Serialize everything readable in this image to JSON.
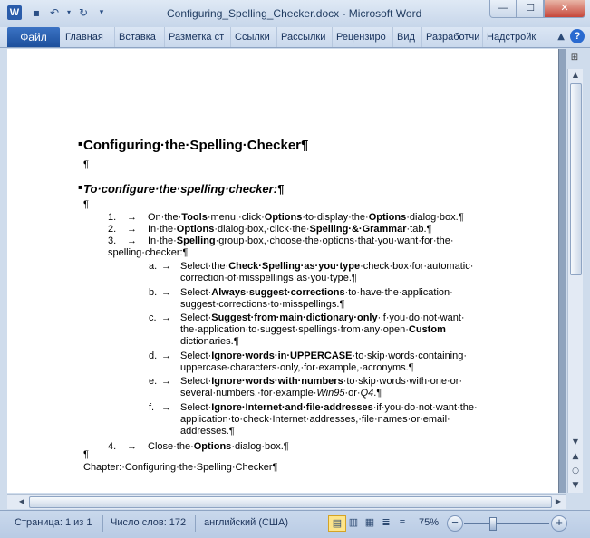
{
  "window": {
    "title": "Configuring_Spelling_Checker.docx - Microsoft Word",
    "app_icon_letter": "W",
    "buttons": {
      "minimize": "—",
      "maximize": "☐",
      "close": "✕"
    }
  },
  "ribbon": {
    "file_tab": "Файл",
    "tabs": [
      "Главная",
      "Вставка",
      "Разметка ст",
      "Ссылки",
      "Рассылки",
      "Рецензиро",
      "Вид",
      "Разработчи",
      "Надстройк"
    ],
    "help": "?"
  },
  "document": {
    "title": "Configuring·the·Spelling·Checker¶",
    "pilcrow": "¶",
    "subtitle": "To·configure·the·spelling·checker:¶",
    "steps": [
      {
        "num": "1.",
        "parts": [
          [
            "",
            "On·the·"
          ],
          [
            "b",
            "Tools"
          ],
          [
            "",
            "·menu,·click·"
          ],
          [
            "b",
            "Options"
          ],
          [
            "",
            "·to·display·the·"
          ],
          [
            "b",
            "Options"
          ],
          [
            "",
            "·dialog·box.¶"
          ]
        ]
      },
      {
        "num": "2.",
        "parts": [
          [
            "",
            "In·the·"
          ],
          [
            "b",
            "Options"
          ],
          [
            "",
            "·dialog·box,·click·the·"
          ],
          [
            "b",
            "Spelling·&·Grammar"
          ],
          [
            "",
            "·tab.¶"
          ]
        ]
      },
      {
        "num": "3.",
        "parts": [
          [
            "",
            "In·the·"
          ],
          [
            "b",
            "Spelling"
          ],
          [
            "",
            "·group·box,·choose·the·options·that·you·want·for·the·"
          ]
        ],
        "cont": "spelling·checker:¶"
      },
      {
        "num": "4.",
        "parts": [
          [
            "",
            "Close·the·"
          ],
          [
            "b",
            "Options"
          ],
          [
            "",
            "·dialog·box.¶"
          ]
        ]
      }
    ],
    "substeps": [
      {
        "letter": "a.",
        "lines": [
          [
            [
              "",
              "Select·the·"
            ],
            [
              "b",
              "Check·Spelling·as·you·type"
            ],
            [
              "",
              "·check·box·for·automatic·"
            ]
          ],
          [
            [
              "",
              "correction·of·misspellings·as·you·type.¶"
            ]
          ]
        ]
      },
      {
        "letter": "b.",
        "lines": [
          [
            [
              "",
              "Select·"
            ],
            [
              "b",
              "Always·suggest·corrections"
            ],
            [
              "",
              "·to·have·the·application·"
            ]
          ],
          [
            [
              "",
              "suggest·corrections·to·misspellings.¶"
            ]
          ]
        ]
      },
      {
        "letter": "c.",
        "lines": [
          [
            [
              "",
              "Select·"
            ],
            [
              "b",
              "Suggest·from·main·dictionary·only"
            ],
            [
              "",
              "·if·you·do·not·want·"
            ]
          ],
          [
            [
              "",
              "the·application·to·suggest·spellings·from·any·open·"
            ],
            [
              "b",
              "Custom"
            ]
          ],
          [
            [
              "",
              "dictionaries.¶"
            ]
          ]
        ]
      },
      {
        "letter": "d.",
        "lines": [
          [
            [
              "",
              "Select·"
            ],
            [
              "b",
              "Ignore·words·in·UPPERCASE"
            ],
            [
              "",
              "·to·skip·words·containing·"
            ]
          ],
          [
            [
              "",
              "uppercase·characters·only,·for·example,·acronyms.¶"
            ]
          ]
        ]
      },
      {
        "letter": "e.",
        "lines": [
          [
            [
              "",
              "Select·"
            ],
            [
              "b",
              "Ignore·words·with·numbers"
            ],
            [
              "",
              "·to·skip·words·with·one·or·"
            ]
          ],
          [
            [
              "",
              "several·numbers,·for·example·"
            ],
            [
              "i",
              "Win95"
            ],
            [
              "",
              "·or·"
            ],
            [
              "i",
              "Q4"
            ],
            [
              "",
              ".¶"
            ]
          ]
        ]
      },
      {
        "letter": "f.",
        "lines": [
          [
            [
              "",
              "Select·"
            ],
            [
              "b",
              "Ignore·Internet·and·file·addresses"
            ],
            [
              "",
              "·if·you·do·not·want·the·"
            ]
          ],
          [
            [
              "",
              "application·to·check·Internet·addresses,·file·names·or·email·"
            ]
          ],
          [
            [
              "",
              "addresses.¶"
            ]
          ]
        ]
      }
    ],
    "arrow": "→",
    "footer": "Chapter:·Configuring·the·Spelling·Checker¶"
  },
  "statusbar": {
    "page": "Страница: 1 из 1",
    "words": "Число слов: 172",
    "language": "английский (США)",
    "zoom": "75%",
    "zoom_minus": "−",
    "zoom_plus": "+"
  }
}
